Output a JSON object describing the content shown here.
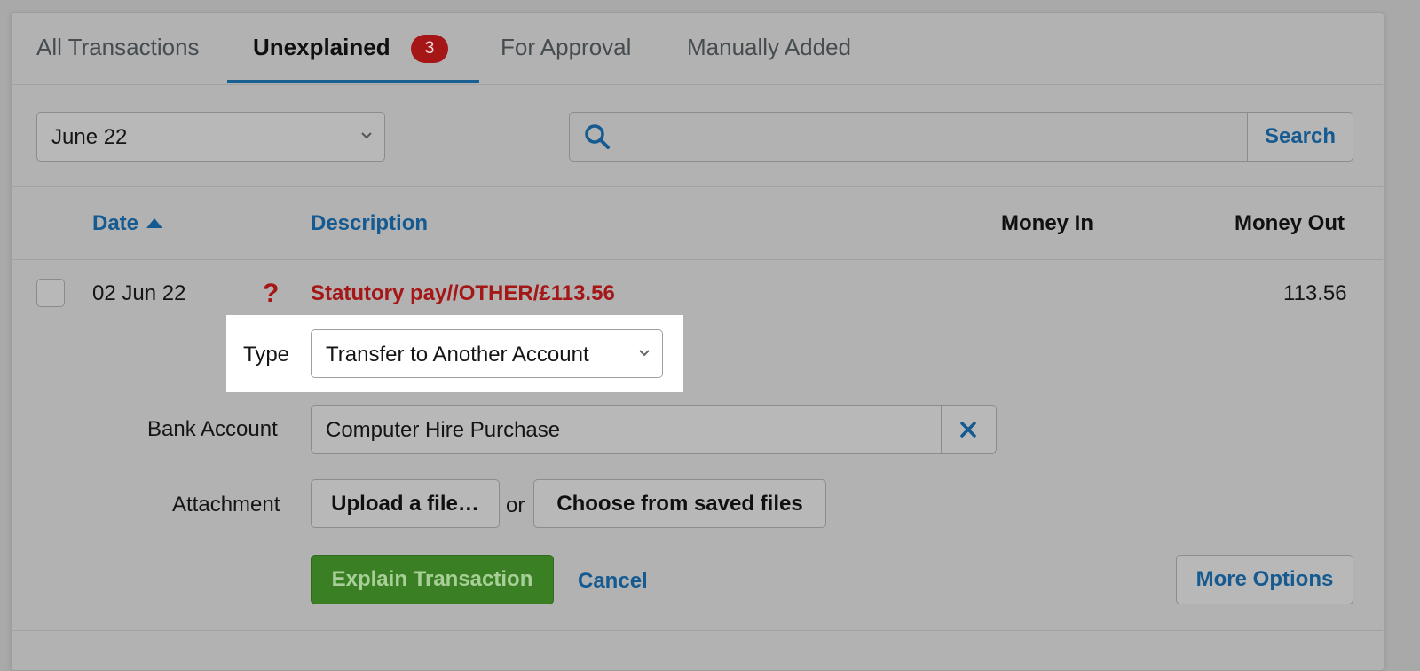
{
  "tabs": [
    {
      "label": "All Transactions"
    },
    {
      "label": "Unexplained",
      "badge": "3",
      "active": true
    },
    {
      "label": "For Approval"
    },
    {
      "label": "Manually Added"
    }
  ],
  "filters": {
    "period_value": "June 22",
    "search_placeholder": "",
    "search_button": "Search"
  },
  "table": {
    "headers": {
      "date": "Date",
      "description": "Description",
      "money_in": "Money In",
      "money_out": "Money Out"
    },
    "row": {
      "date": "02 Jun 22",
      "status_icon": "question-mark-icon",
      "description": "Statutory pay//OTHER/£113.56",
      "money_in": "",
      "money_out": "113.56"
    }
  },
  "explain_form": {
    "type_label": "Type",
    "type_value": "Transfer to Another Account",
    "bank_account_label": "Bank Account",
    "bank_account_value": "Computer Hire Purchase",
    "attachment_label": "Attachment",
    "upload_button": "Upload a file…",
    "or_text": "or",
    "saved_files_button": "Choose from saved files",
    "explain_button": "Explain Transaction",
    "cancel_link": "Cancel",
    "more_options_button": "More Options"
  },
  "colors": {
    "accent_blue": "#155a90",
    "alert_red": "#a51616",
    "primary_green": "#3a7f24"
  }
}
